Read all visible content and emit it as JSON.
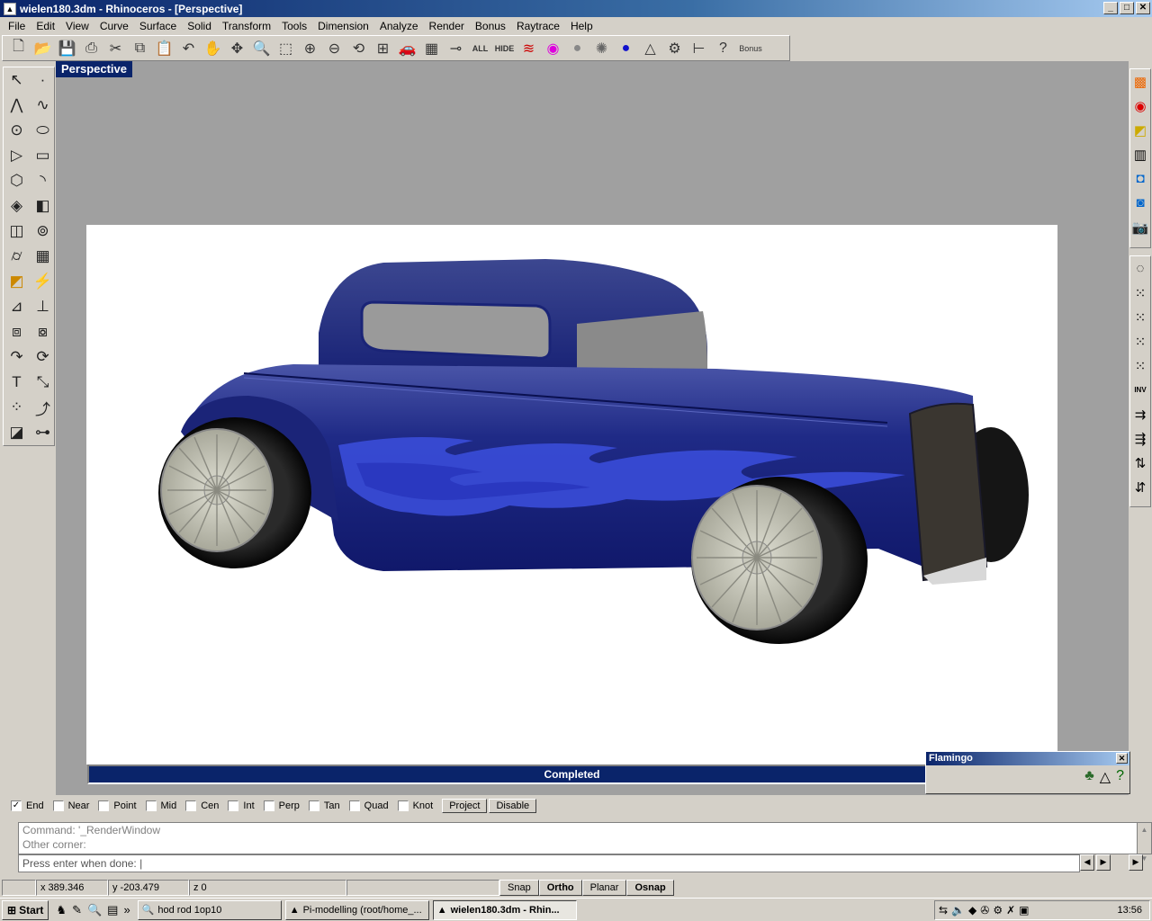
{
  "window": {
    "title": "wielen180.3dm - Rhinoceros - [Perspective]",
    "min": "_",
    "max": "□",
    "close": "✕"
  },
  "menu": [
    "File",
    "Edit",
    "View",
    "Curve",
    "Surface",
    "Solid",
    "Transform",
    "Tools",
    "Dimension",
    "Analyze",
    "Render",
    "Bonus",
    "Raytrace",
    "Help"
  ],
  "toolbar": {
    "all_label": "ALL",
    "hide_label": "HIDE",
    "bonus_label": "Bonus"
  },
  "viewport": {
    "label": "Perspective"
  },
  "render": {
    "status": "Completed",
    "body_color": "#1e2a7a",
    "flame_color": "#3a4cd8"
  },
  "flamingo": {
    "title": "Flamingo",
    "close": "✕"
  },
  "osnaps": [
    {
      "label": "End",
      "checked": true
    },
    {
      "label": "Near",
      "checked": false
    },
    {
      "label": "Point",
      "checked": false
    },
    {
      "label": "Mid",
      "checked": false
    },
    {
      "label": "Cen",
      "checked": false
    },
    {
      "label": "Int",
      "checked": false
    },
    {
      "label": "Perp",
      "checked": false
    },
    {
      "label": "Tan",
      "checked": false
    },
    {
      "label": "Quad",
      "checked": false
    },
    {
      "label": "Knot",
      "checked": false
    }
  ],
  "osnap_buttons": {
    "project": "Project",
    "disable": "Disable"
  },
  "command": {
    "history1": "Command: '_RenderWindow",
    "history2": "Other corner:",
    "prompt": "Press enter when done:"
  },
  "status": {
    "x": "x 389.346",
    "y": "y -203.479",
    "z": "z 0",
    "snap": "Snap",
    "ortho": "Ortho",
    "planar": "Planar",
    "osnap": "Osnap"
  },
  "taskbar": {
    "start": "Start",
    "more": "»",
    "tasks": [
      {
        "label": "hod rod 1op10",
        "active": false
      },
      {
        "label": "Pi-modelling (root/home_...",
        "active": false
      },
      {
        "label": "wielen180.3dm - Rhin...",
        "active": true
      }
    ],
    "clock": "13:56"
  }
}
